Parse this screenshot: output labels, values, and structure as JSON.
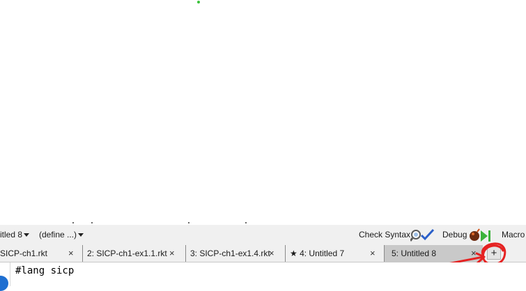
{
  "toolbar": {
    "file_menu_label": "itled 8",
    "define_menu_label": "(define ...)",
    "check_syntax_label": "Check Syntax",
    "debug_label": "Debug",
    "macro_label": "Macro"
  },
  "tabs": [
    {
      "label": "SICP-ch1.rkt",
      "close": "×",
      "active": false
    },
    {
      "label": "2: SICP-ch1-ex1.1.rkt",
      "close": "×",
      "active": false
    },
    {
      "label": "3: SICP-ch1-ex1.4.rkt",
      "close": "×",
      "active": false
    },
    {
      "label": "★ 4: Untitled 7",
      "close": "×",
      "active": false
    },
    {
      "label": "5: Untitled 8",
      "close": "×",
      "active": true
    }
  ],
  "new_tab_label": "+",
  "editor": {
    "first_line": "#lang sicp"
  },
  "colors": {
    "annotation": "#e52222",
    "active_tab": "#c9c9c9",
    "toolbar_bg": "#f0f0f0"
  }
}
